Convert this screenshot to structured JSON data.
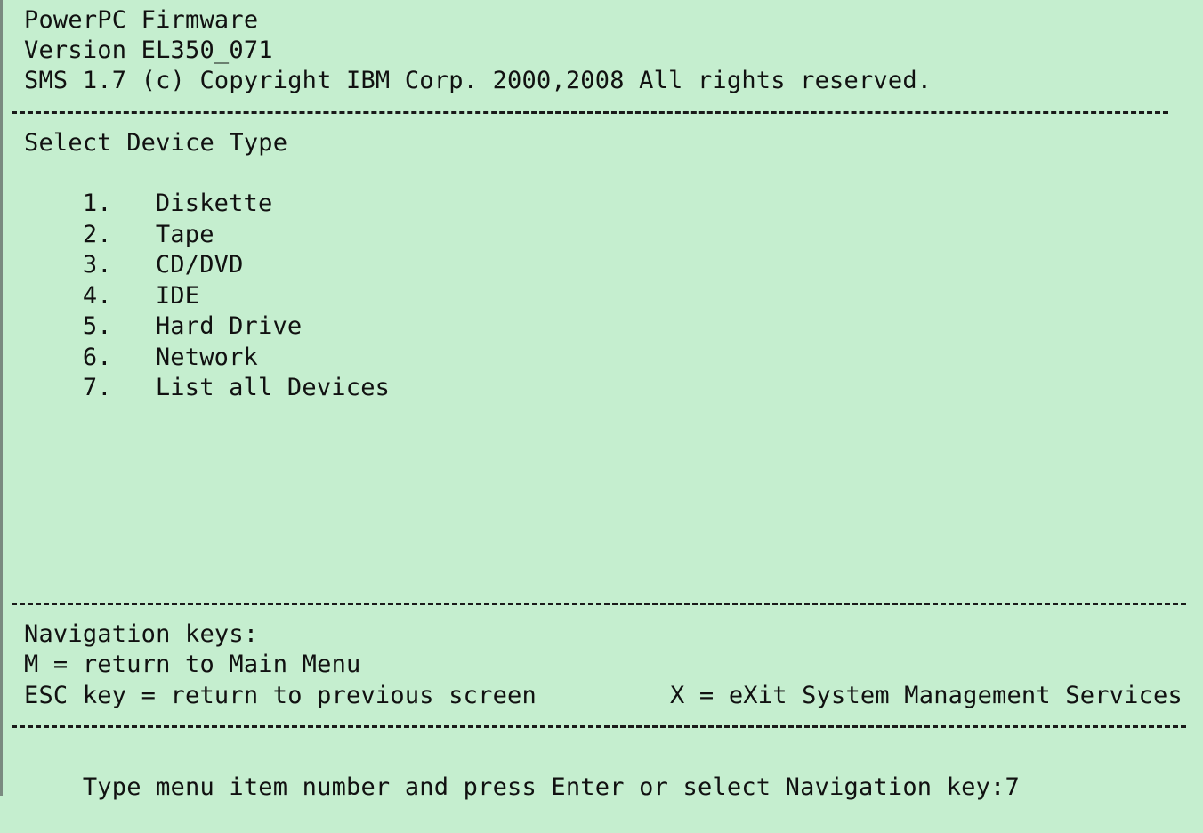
{
  "header": {
    "firmware": "PowerPC Firmware",
    "version": "Version EL350_071",
    "copyright": "SMS 1.7 (c) Copyright IBM Corp. 2000,2008 All rights reserved."
  },
  "menu": {
    "title": "Select Device Type",
    "items": [
      {
        "number": "1.",
        "label": "Diskette"
      },
      {
        "number": "2.",
        "label": "Tape"
      },
      {
        "number": "3.",
        "label": "CD/DVD"
      },
      {
        "number": "4.",
        "label": "IDE"
      },
      {
        "number": "5.",
        "label": "Hard Drive"
      },
      {
        "number": "6.",
        "label": "Network"
      },
      {
        "number": "7.",
        "label": "List all Devices"
      }
    ]
  },
  "navigation": {
    "title": "Navigation keys:",
    "main_menu": "M = return to Main Menu",
    "escape": "ESC key = return to previous screen",
    "exit": "X = eXit System Management Services"
  },
  "prompt": {
    "text": "Type menu item number and press Enter or select Navigation key:",
    "value": "7"
  },
  "colors": {
    "background": "#c5eecf",
    "text": "#111111"
  }
}
